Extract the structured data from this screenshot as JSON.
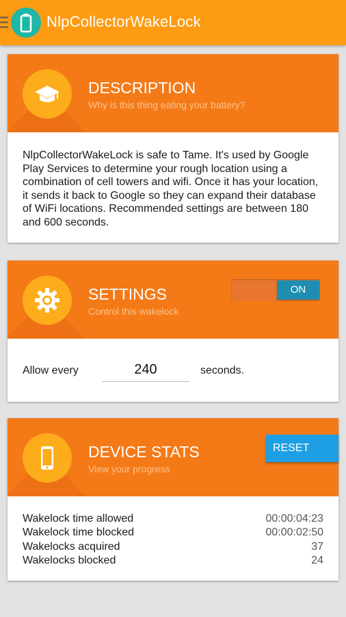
{
  "app_bar": {
    "title": "NlpCollectorWakeLock",
    "menu_icon": "hamburger-menu-icon",
    "app_icon": "battery-icon"
  },
  "colors": {
    "app_bar": "#fd9b12",
    "card_header": "#f47a18",
    "badge": "#fdac1b",
    "toggle_on": "#1f8db0",
    "reset_button": "#1e9fe3",
    "app_icon": "#1fb7a6"
  },
  "description": {
    "title": "DESCRIPTION",
    "subtitle": "Why is this thing eating your battery?",
    "icon": "graduation-cap-icon",
    "text": "NlpCollectorWakeLock is safe to Tame. It's used by Google Play Services to determine your rough location using a combination of cell towers and wifi. Once it has your location, it sends it back to Google so they can expand their database of WiFi locations. Recommended settings are between 180 and 600 seconds."
  },
  "settings": {
    "title": "SETTINGS",
    "subtitle": "Control this wakelock",
    "icon": "gear-icon",
    "toggle_label": "ON",
    "toggle_on": true,
    "allow_label": "Allow every",
    "interval_value": "240",
    "seconds_label": "seconds."
  },
  "device_stats": {
    "title": "DEVICE STATS",
    "subtitle": "View your progress",
    "icon": "smartphone-icon",
    "reset_label": "RESET",
    "rows": [
      {
        "label": "Wakelock time allowed",
        "value": "00:00:04:23"
      },
      {
        "label": "Wakelock time blocked",
        "value": "00:00:02:50"
      },
      {
        "label": "Wakelocks acquired",
        "value": "37"
      },
      {
        "label": "Wakelocks blocked",
        "value": "24"
      }
    ]
  }
}
